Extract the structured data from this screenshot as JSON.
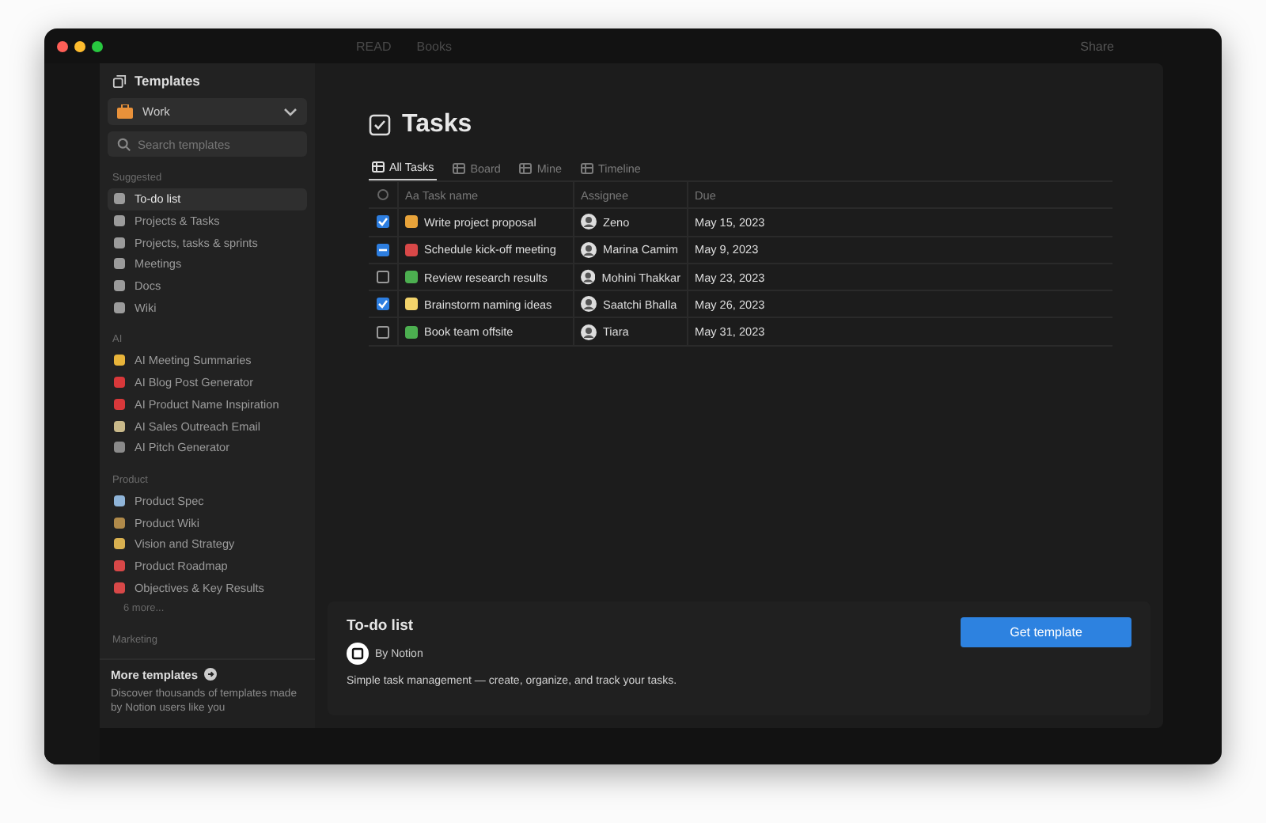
{
  "titlebar": {
    "breadcrumbs": [
      "READ",
      "Books"
    ],
    "share": "Share"
  },
  "templates": {
    "title": "Templates",
    "workspace": "Work",
    "search": {
      "placeholder": "Search templates"
    },
    "sections": [
      {
        "heading": "Suggested",
        "items": [
          {
            "label": "To-do list",
            "selected": true,
            "color": "#9b9b9b"
          },
          {
            "label": "Projects & Tasks",
            "selected": false,
            "color": "#9b9b9b"
          },
          {
            "label": "Projects, tasks & sprints",
            "selected": false,
            "color": "#9b9b9b"
          },
          {
            "label": "Meetings",
            "selected": false,
            "color": "#9b9b9b"
          },
          {
            "label": "Docs",
            "selected": false,
            "color": "#9b9b9b"
          },
          {
            "label": "Wiki",
            "selected": false,
            "color": "#9b9b9b"
          }
        ]
      },
      {
        "heading": "AI",
        "items": [
          {
            "label": "AI Meeting Summaries",
            "selected": false,
            "color": "#e8b43a"
          },
          {
            "label": "AI Blog Post Generator",
            "selected": false,
            "color": "#d8383a"
          },
          {
            "label": "AI Product Name Inspiration",
            "selected": false,
            "color": "#d8383a"
          },
          {
            "label": "AI Sales Outreach Email",
            "selected": false,
            "color": "#c9b98a"
          },
          {
            "label": "AI Pitch Generator",
            "selected": false,
            "color": "#8a8a8a"
          }
        ]
      },
      {
        "heading": "Product",
        "items": [
          {
            "label": "Product Spec",
            "selected": false,
            "color": "#8fb4d8"
          },
          {
            "label": "Product Wiki",
            "selected": false,
            "color": "#b08a4a"
          },
          {
            "label": "Vision and Strategy",
            "selected": false,
            "color": "#d8b050"
          },
          {
            "label": "Product Roadmap",
            "selected": false,
            "color": "#d84848"
          },
          {
            "label": "Objectives & Key Results",
            "selected": false,
            "color": "#d84848"
          }
        ]
      }
    ],
    "more": "6 more...",
    "next_heading": "Marketing",
    "footer": {
      "title": "More templates",
      "text": "Discover thousands of templates made by Notion users like you"
    }
  },
  "preview": {
    "title": "Tasks",
    "views": [
      {
        "label": "All Tasks",
        "selected": true
      },
      {
        "label": "Board",
        "selected": false
      },
      {
        "label": "Mine",
        "selected": false
      },
      {
        "label": "Timeline",
        "selected": false
      }
    ],
    "columns": [
      "Aa Task name",
      "Assignee",
      "Due"
    ],
    "rows": [
      {
        "checked": true,
        "partial": false,
        "task": "Write project proposal",
        "color": "#e8a33a",
        "assignee": "Zeno",
        "due": "May 15, 2023"
      },
      {
        "checked": true,
        "partial": true,
        "task": "Schedule kick-off meeting",
        "color": "#d84848",
        "assignee": "Marina Camim",
        "due": "May 9, 2023"
      },
      {
        "checked": false,
        "partial": false,
        "task": "Review research results",
        "color": "#4caf50",
        "assignee": "Mohini Thakkar",
        "due": "May 23, 2023"
      },
      {
        "checked": true,
        "partial": false,
        "task": "Brainstorm naming ideas",
        "color": "#f2d36b",
        "assignee": "Saatchi Bhalla",
        "due": "May 26, 2023"
      },
      {
        "checked": false,
        "partial": false,
        "task": "Book team offsite",
        "color": "#4caf50",
        "assignee": "Tiara",
        "due": "May 31, 2023"
      }
    ]
  },
  "detail": {
    "title": "To-do list",
    "author": "By Notion",
    "button": "Get template",
    "description": "Simple task management — create, organize, and track your tasks."
  }
}
